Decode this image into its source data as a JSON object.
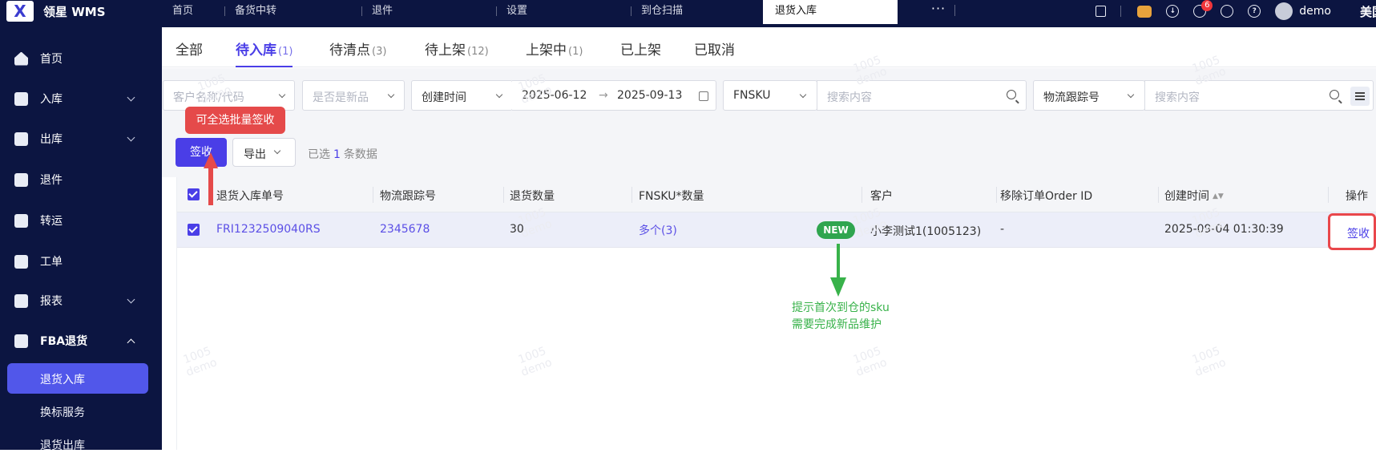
{
  "app": {
    "logo_text": "领星 WMS",
    "logo_mark": "X"
  },
  "top_tabs": [
    {
      "label": "首页",
      "active": false
    },
    {
      "label": "备货中转",
      "active": false
    },
    {
      "label": "退件",
      "active": false
    },
    {
      "label": "设置",
      "active": false
    },
    {
      "label": "到仓扫描",
      "active": false
    },
    {
      "label": "退货入库",
      "active": true
    }
  ],
  "top_more": "···",
  "top_right": {
    "notification_count": "6",
    "user": "demo",
    "region": "美国"
  },
  "sidebar": {
    "items": [
      {
        "label": "首页",
        "icon": "home-icon",
        "has_children": false
      },
      {
        "label": "入库",
        "icon": "inbound-icon",
        "has_children": true
      },
      {
        "label": "出库",
        "icon": "outbound-icon",
        "has_children": true
      },
      {
        "label": "退件",
        "icon": "return-icon",
        "has_children": false
      },
      {
        "label": "转运",
        "icon": "transfer-icon",
        "has_children": false
      },
      {
        "label": "工单",
        "icon": "workorder-icon",
        "has_children": false
      },
      {
        "label": "报表",
        "icon": "report-icon",
        "has_children": true
      },
      {
        "label": "FBA退货",
        "icon": "fba-return-icon",
        "has_children": true,
        "expanded": true
      }
    ],
    "sub_items": [
      {
        "label": "退货入库",
        "active": true
      },
      {
        "label": "换标服务",
        "active": false
      },
      {
        "label": "退货出库",
        "active": false
      }
    ]
  },
  "status_tabs": [
    {
      "label": "全部",
      "count": ""
    },
    {
      "label": "待入库",
      "count": "(1)",
      "active": true
    },
    {
      "label": "待清点",
      "count": "(3)"
    },
    {
      "label": "待上架",
      "count": "(12)"
    },
    {
      "label": "上架中",
      "count": "(1)"
    },
    {
      "label": "已上架",
      "count": ""
    },
    {
      "label": "已取消",
      "count": ""
    }
  ],
  "filters": {
    "customer_placeholder": "客户名称/代码",
    "is_new_placeholder": "是否是新品",
    "time_type": "创建时间",
    "date_start": "2025-06-12",
    "date_end": "2025-09-13",
    "sku_type": "FNSKU",
    "search_placeholder_1": "搜索内容",
    "tracking_type": "物流跟踪号",
    "search_placeholder_2": "搜索内容"
  },
  "actions": {
    "sign_label": "签收",
    "export_label": "导出",
    "selected_prefix": "已选",
    "selected_count": "1",
    "selected_suffix": "条数据"
  },
  "annotations": {
    "tooltip": "可全选批量签收",
    "green_note_line1": "提示首次到仓的sku",
    "green_note_line2": "需要完成新品维护"
  },
  "table": {
    "headers": [
      "退货入库单号",
      "物流跟踪号",
      "退货数量",
      "FNSKU*数量",
      "客户",
      "移除订单Order ID",
      "创建时间",
      "操作"
    ],
    "rows": [
      {
        "order_no": "FRI1232509040RS",
        "tracking": "2345678",
        "qty": "30",
        "fnsku": "多个(3)",
        "new_badge": "NEW",
        "customer": "小李测试1(1005123)",
        "removal_id": "-",
        "created": "2025-09-04 01:30:39",
        "op": "签收"
      }
    ]
  },
  "watermark": "1005\ndemo",
  "colors": {
    "nav_bg": "#0c1541",
    "primary": "#4a3ee7",
    "annotation_red": "#e54a4a",
    "annotation_green": "#38b24a",
    "new_badge": "#2fa54f"
  }
}
